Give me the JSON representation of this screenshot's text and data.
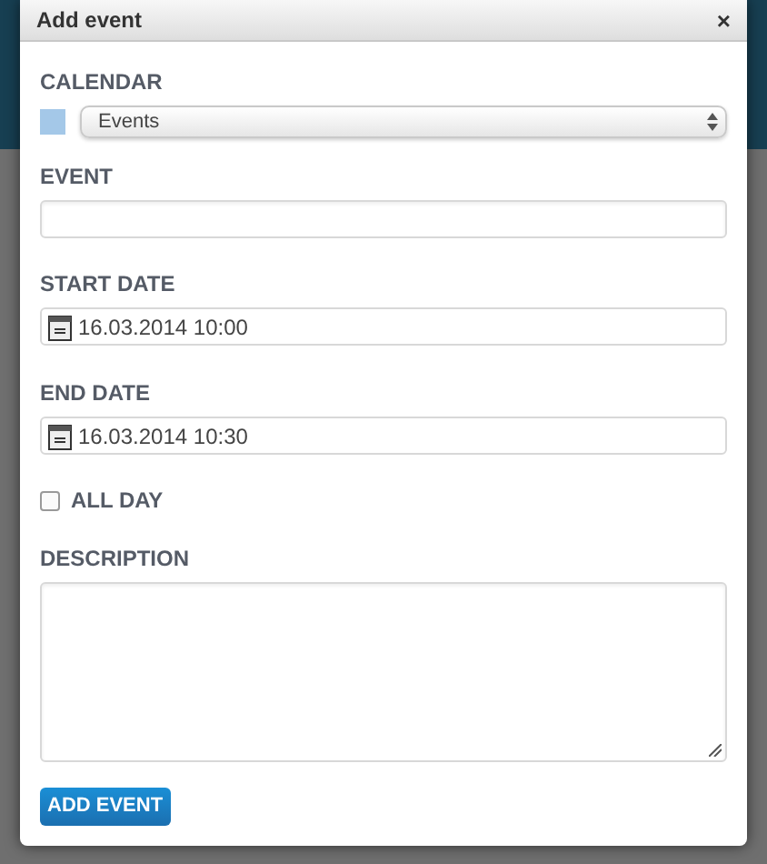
{
  "dialog": {
    "title": "Add event",
    "close": "×"
  },
  "calendar": {
    "label": "CALENDAR",
    "color": "#a4c8e8",
    "value": "Events"
  },
  "event": {
    "label": "EVENT"
  },
  "start_date": {
    "label": "START DATE",
    "value": "16.03.2014 10:00"
  },
  "end_date": {
    "label": "END DATE",
    "value": "16.03.2014 10:30"
  },
  "all_day": {
    "label": "ALL DAY",
    "checked": false
  },
  "description": {
    "label": "DESCRIPTION"
  },
  "submit": "ADD EVENT"
}
